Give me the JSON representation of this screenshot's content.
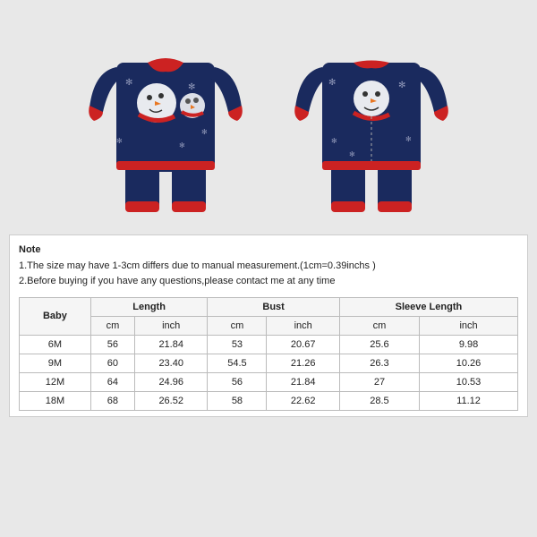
{
  "images": [
    {
      "id": "front-view",
      "alt": "Baby Christmas Romper Front View"
    },
    {
      "id": "back-view",
      "alt": "Baby Christmas Romper Back View"
    }
  ],
  "note": {
    "title": "Note",
    "lines": [
      "1.The size may have 1-3cm differs due to manual measurement.(1cm=0.39inchs )",
      "2.Before buying if you have any questions,please contact me at any time"
    ]
  },
  "table": {
    "category": "Baby",
    "columns": [
      {
        "group": "Length",
        "sub": [
          "cm",
          "inch"
        ]
      },
      {
        "group": "Bust",
        "sub": [
          "cm",
          "inch"
        ]
      },
      {
        "group": "Sleeve Length",
        "sub": [
          "cm",
          "inch"
        ]
      }
    ],
    "rows": [
      {
        "size": "6M",
        "length_cm": "56",
        "length_inch": "21.84",
        "bust_cm": "53",
        "bust_inch": "20.67",
        "sleeve_cm": "25.6",
        "sleeve_inch": "9.98"
      },
      {
        "size": "9M",
        "length_cm": "60",
        "length_inch": "23.40",
        "bust_cm": "54.5",
        "bust_inch": "21.26",
        "sleeve_cm": "26.3",
        "sleeve_inch": "10.26"
      },
      {
        "size": "12M",
        "length_cm": "64",
        "length_inch": "24.96",
        "bust_cm": "56",
        "bust_inch": "21.84",
        "sleeve_cm": "27",
        "sleeve_inch": "10.53"
      },
      {
        "size": "18M",
        "length_cm": "68",
        "length_inch": "26.52",
        "bust_cm": "58",
        "bust_inch": "22.62",
        "sleeve_cm": "28.5",
        "sleeve_inch": "11.12"
      }
    ]
  }
}
